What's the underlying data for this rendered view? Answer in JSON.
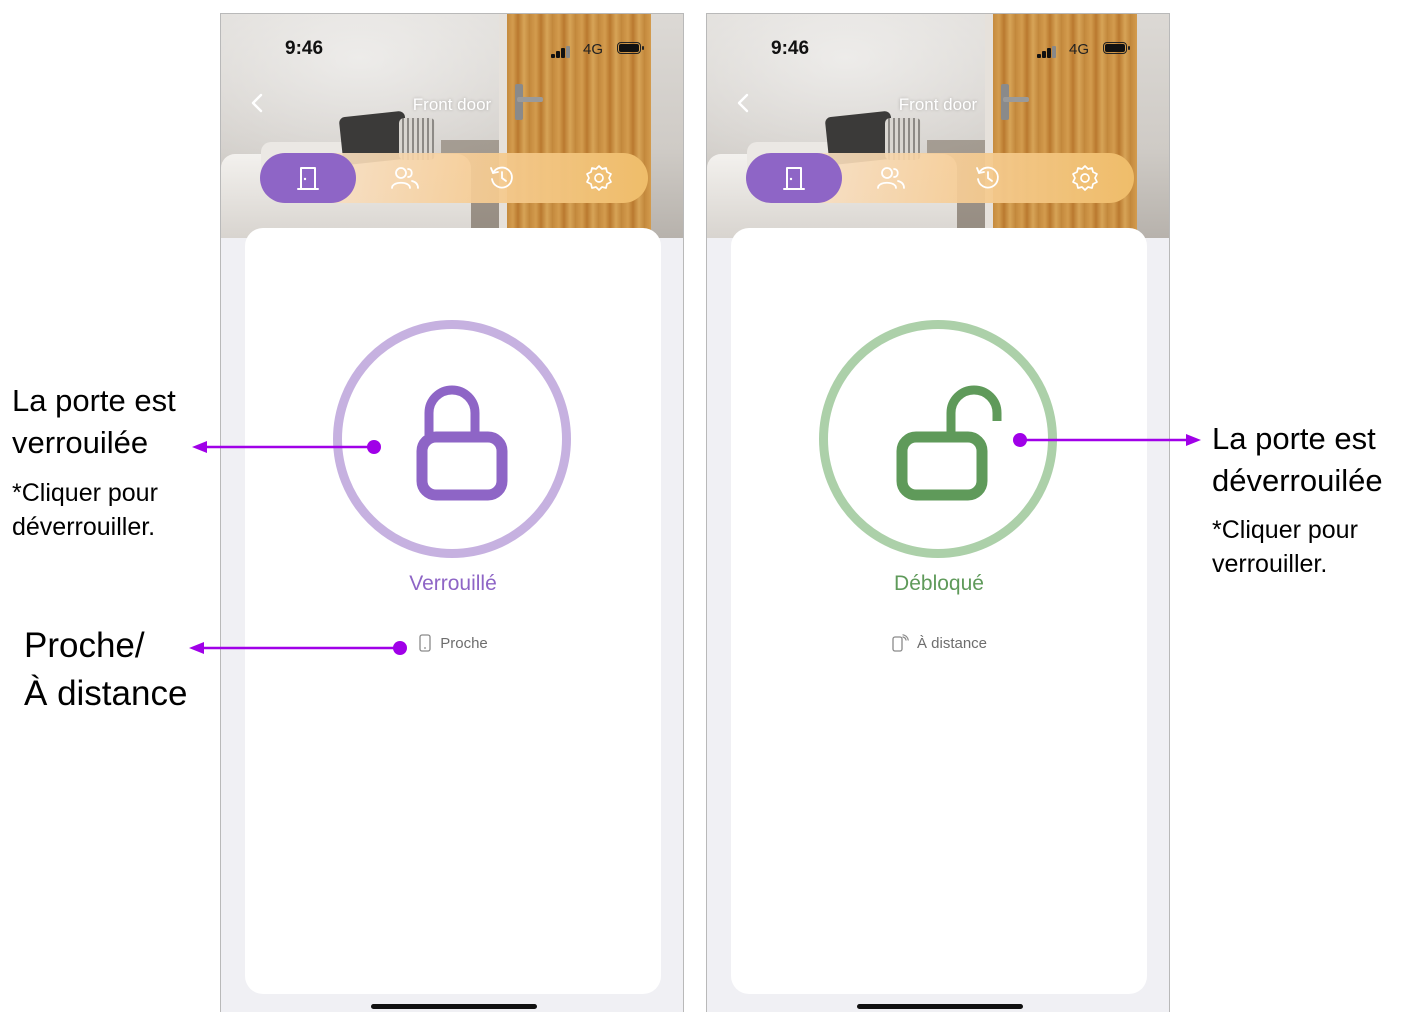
{
  "colors": {
    "locked_accent": "#8e65c6",
    "locked_ring": "#c6b1e0",
    "unlocked_accent": "#5f9a5a",
    "unlocked_ring": "#acd0a9",
    "annotation_arrow": "#a000e8"
  },
  "screens": [
    {
      "status_time": "9:46",
      "network": "4G",
      "title": "Front door",
      "tabs": [
        "door-icon",
        "users-icon",
        "history-icon",
        "settings-icon"
      ],
      "active_tab": 0,
      "lock_state": "Verrouillé",
      "mode_icon": "phone-icon",
      "mode_label": "Proche"
    },
    {
      "status_time": "9:46",
      "network": "4G",
      "title": "Front door",
      "tabs": [
        "door-icon",
        "users-icon",
        "history-icon",
        "settings-icon"
      ],
      "active_tab": 0,
      "lock_state": "Débloqué",
      "mode_icon": "remote-phone-icon",
      "mode_label": "À distance"
    }
  ],
  "annotations": {
    "locked_title_1": "La porte est",
    "locked_title_2": "verrouilée",
    "locked_note_1": "*Cliquer pour",
    "locked_note_2": "déverrouiller.",
    "proximity_1": "Proche/",
    "proximity_2": "À distance",
    "unlocked_title_1": "La porte est",
    "unlocked_title_2": "déverrouilée",
    "unlocked_note_1": "*Cliquer pour",
    "unlocked_note_2": "verrouiller."
  }
}
